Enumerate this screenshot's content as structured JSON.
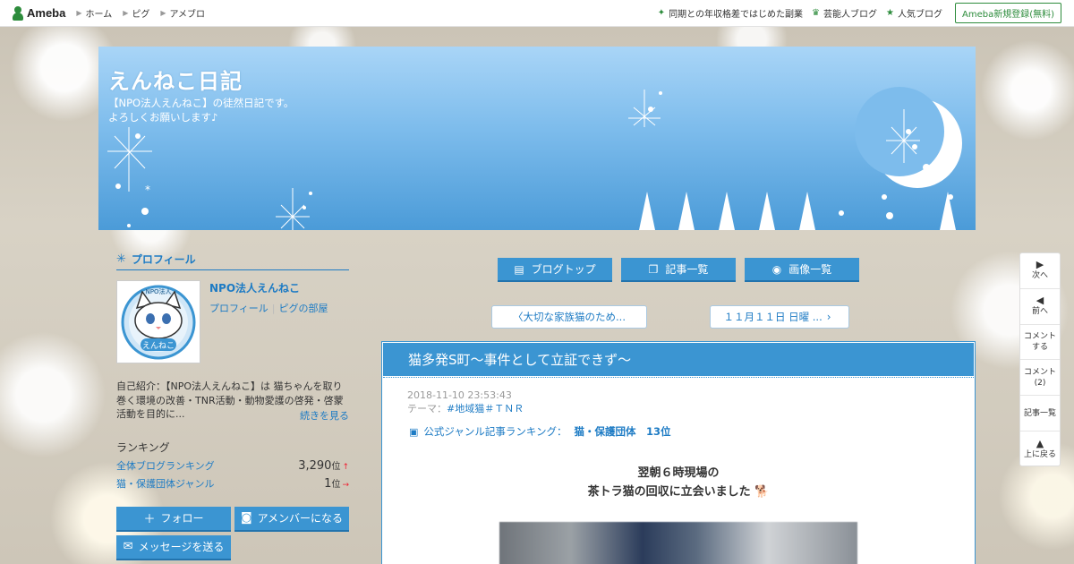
{
  "topbar": {
    "logo": "Ameba",
    "nav": [
      "ホーム",
      "ピグ",
      "アメブロ"
    ],
    "links": [
      {
        "icon": "sparkle-icon",
        "label": "同期との年収格差ではじめた副業"
      },
      {
        "icon": "crown-icon",
        "label": "芸能人ブログ"
      },
      {
        "icon": "star-icon",
        "label": "人気ブログ"
      }
    ],
    "register": "Ameba新規登録(無料)"
  },
  "banner": {
    "title": "えんねこ日記",
    "description": "【NPO法人えんねこ】の徒然日記です。\nよろしくお願いします♪"
  },
  "sidebar": {
    "profile_heading": "プロフィール",
    "name": "NPO法人えんねこ",
    "avatar_badge": "NPO法人",
    "avatar_caption": "えんねこ",
    "link_profile": "プロフィール",
    "link_room": "ピグの部屋",
    "intro": "自己紹介：【NPO法人えんねこ】は 猫ちゃんを取り巻く環境の改善・TNR活動・動物愛護の啓発・啓蒙活動を目的に...",
    "more": "続きを見る",
    "ranking_title": "ランキング",
    "rankings": [
      {
        "label": "全体ブログランキング",
        "value": "3,290",
        "unit": "位",
        "trend": "↑"
      },
      {
        "label": "猫・保護団体ジャンル",
        "value": "1",
        "unit": "位",
        "trend": "→"
      }
    ],
    "follow": "フォロー",
    "amember": "アメンバーになる",
    "message": "メッセージを送る"
  },
  "nav": {
    "blog_top": "ブログトップ",
    "articles": "記事一覧",
    "images": "画像一覧",
    "prev": "〈大切な家族猫のため...",
    "next": "１１月１１日 日曜 ..."
  },
  "article": {
    "title": "猫多発S町〜事件として立証できず〜",
    "datetime": "2018-11-10 23:53:43",
    "theme_label": "テーマ：",
    "theme": "#地域猫＃ＴＮＲ",
    "genre_label": "公式ジャンル記事ランキング：",
    "genre_value": "猫・保護団体　13位",
    "body_line1": "翌朝６時現場の",
    "body_line2": "茶トラ猫の回収に立会いました 🐕"
  },
  "float_nav": {
    "next": "次へ",
    "prev": "前へ",
    "comment_write": "コメント\nする",
    "comment_count": "コメント\n(2)",
    "article_list": "記事一覧",
    "to_top": "上に戻る"
  }
}
